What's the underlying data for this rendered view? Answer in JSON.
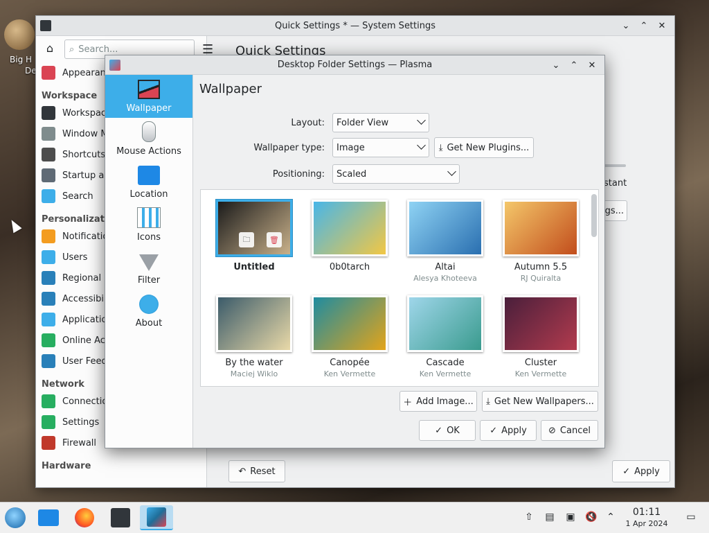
{
  "desktop": {
    "icon_label_line1": "Big H",
    "icon_label_line2": "De"
  },
  "sys_window": {
    "title": "Quick Settings * — System Settings",
    "search_placeholder": "Search...",
    "main_title": "Quick Settings",
    "peek_instant": "stant",
    "peek_button": "gs...",
    "reset_label": "Reset",
    "apply_label": "Apply",
    "sidebar": [
      {
        "type": "item",
        "label": "Appearance",
        "icon": "appearance-icon",
        "color": "#da4453"
      },
      {
        "type": "head",
        "label": "Workspace"
      },
      {
        "type": "item",
        "label": "Workspace",
        "icon": "workspace-icon",
        "color": "#31363b"
      },
      {
        "type": "item",
        "label": "Window M",
        "icon": "window-icon",
        "color": "#7f8c8d"
      },
      {
        "type": "item",
        "label": "Shortcuts",
        "icon": "keyboard-icon",
        "color": "#4d4d4d"
      },
      {
        "type": "item",
        "label": "Startup an",
        "icon": "startup-icon",
        "color": "#5f6a75"
      },
      {
        "type": "item",
        "label": "Search",
        "icon": "search-icon",
        "color": "#3daee9"
      },
      {
        "type": "head",
        "label": "Personalization"
      },
      {
        "type": "item",
        "label": "Notification",
        "icon": "bell-icon",
        "color": "#f39c1f"
      },
      {
        "type": "item",
        "label": "Users",
        "icon": "users-icon",
        "color": "#3daee9"
      },
      {
        "type": "item",
        "label": "Regional S",
        "icon": "regional-icon",
        "color": "#2980b9"
      },
      {
        "type": "item",
        "label": "Accessibili",
        "icon": "accessibility-icon",
        "color": "#2980b9"
      },
      {
        "type": "item",
        "label": "Application",
        "icon": "applications-icon",
        "color": "#3daee9"
      },
      {
        "type": "item",
        "label": "Online Acc",
        "icon": "online-accounts-icon",
        "color": "#27ae60"
      },
      {
        "type": "item",
        "label": "User Feed",
        "icon": "feedback-icon",
        "color": "#2980b9"
      },
      {
        "type": "head",
        "label": "Network"
      },
      {
        "type": "item",
        "label": "Connectio",
        "icon": "globe-icon",
        "color": "#27ae60"
      },
      {
        "type": "item",
        "label": "Settings",
        "icon": "globe-icon",
        "color": "#27ae60"
      },
      {
        "type": "item",
        "label": "Firewall",
        "icon": "firewall-icon",
        "color": "#c0392b"
      },
      {
        "type": "head",
        "label": "Hardware"
      }
    ]
  },
  "dialog": {
    "title": "Desktop Folder Settings — Plasma",
    "page_title": "Wallpaper",
    "categories": [
      {
        "label": "Wallpaper",
        "icon": "wallpaper-icon",
        "selected": true
      },
      {
        "label": "Mouse Actions",
        "icon": "mouse-icon",
        "selected": false
      },
      {
        "label": "Location",
        "icon": "folder-icon",
        "selected": false
      },
      {
        "label": "Icons",
        "icon": "icons-icon",
        "selected": false
      },
      {
        "label": "Filter",
        "icon": "filter-icon",
        "selected": false
      },
      {
        "label": "About",
        "icon": "info-icon",
        "selected": false
      }
    ],
    "layout_label": "Layout:",
    "layout_value": "Folder View",
    "wallpaper_type_label": "Wallpaper type:",
    "wallpaper_type_value": "Image",
    "get_plugins_label": "Get New Plugins...",
    "positioning_label": "Positioning:",
    "positioning_value": "Scaled",
    "wallpapers": [
      {
        "name": "Untitled",
        "author": "",
        "selected": true,
        "colors": [
          "#1b1b1b",
          "#c9b18a"
        ]
      },
      {
        "name": "0b0tarch",
        "author": "",
        "selected": false,
        "colors": [
          "#48b6e8",
          "#f2c744"
        ]
      },
      {
        "name": "Altai",
        "author": "Alesya Khoteeva",
        "selected": false,
        "colors": [
          "#8fd3f4",
          "#2a6fb0"
        ]
      },
      {
        "name": "Autumn 5.5",
        "author": "RJ Quiralta",
        "selected": false,
        "colors": [
          "#f4c76a",
          "#c24d1c"
        ]
      },
      {
        "name": "By the water",
        "author": "Maciej Wiklo",
        "selected": false,
        "colors": [
          "#3b5b6a",
          "#e9d9a8"
        ]
      },
      {
        "name": "Canopée",
        "author": "Ken Vermette",
        "selected": false,
        "colors": [
          "#1f8ca0",
          "#e3a41a"
        ]
      },
      {
        "name": "Cascade",
        "author": "Ken Vermette",
        "selected": false,
        "colors": [
          "#9fd6ea",
          "#3a9b8e"
        ]
      },
      {
        "name": "Cluster",
        "author": "Ken Vermette",
        "selected": false,
        "colors": [
          "#4a1f3b",
          "#b23b4e"
        ]
      }
    ],
    "add_image_label": "Add Image...",
    "get_wallpapers_label": "Get New Wallpapers...",
    "ok_label": "OK",
    "apply_label": "Apply",
    "cancel_label": "Cancel"
  },
  "taskbar": {
    "time": "01:11",
    "date": "1 Apr 2024",
    "accent": "#3daee9"
  }
}
